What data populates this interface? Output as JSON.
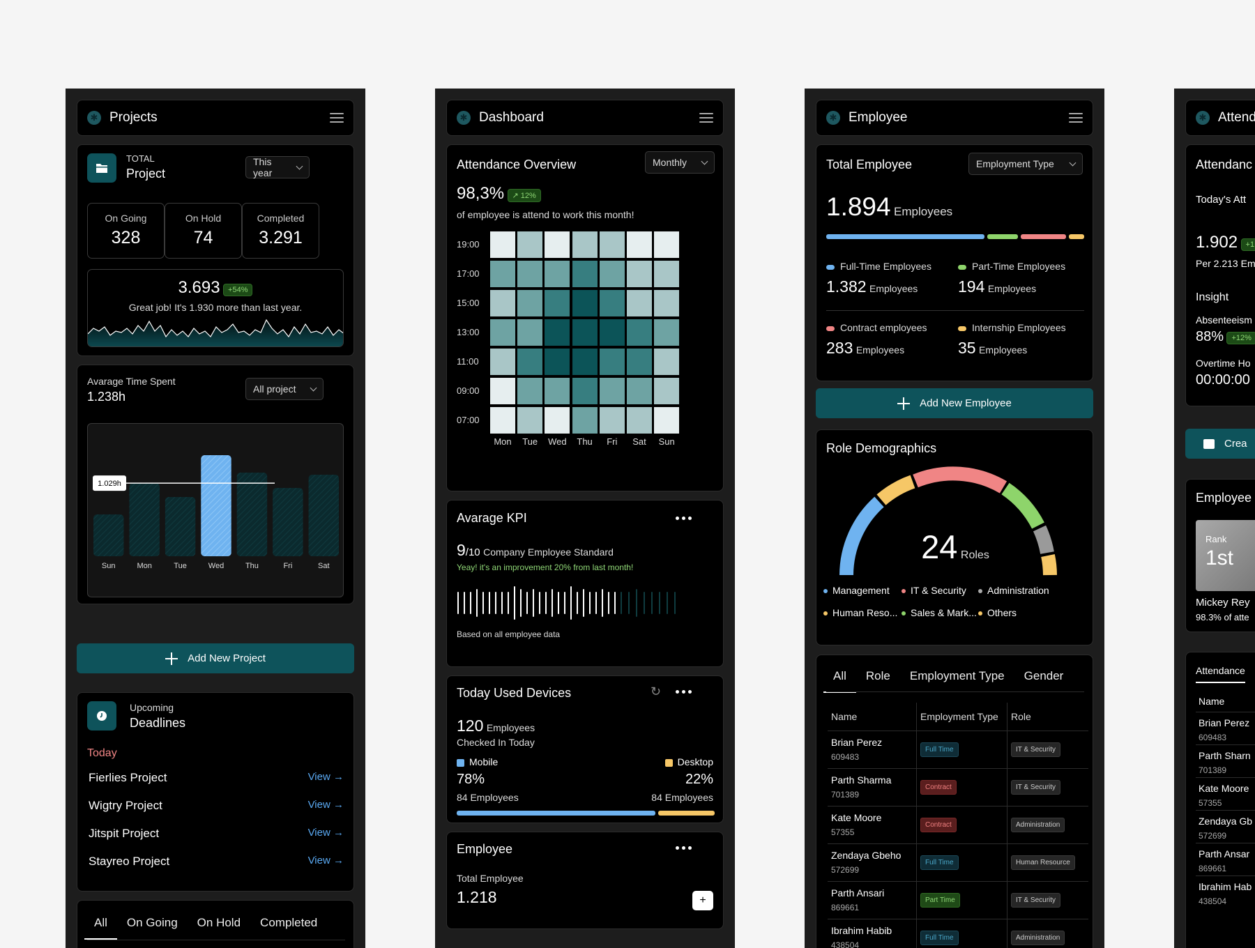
{
  "projects": {
    "title": "Projects",
    "total_label": "TOTAL",
    "total_title": "Project",
    "period": "This year",
    "stats": [
      {
        "label": "On Going",
        "value": "328"
      },
      {
        "label": "On Hold",
        "value": "74"
      },
      {
        "label": "Completed",
        "value": "3.291"
      }
    ],
    "total_value": "3.693",
    "total_badge": "+54%",
    "total_note": "Great job! It's 1.930 more than last year.",
    "avg_title": "Avarage Time Spent",
    "avg_value": "1.238h",
    "avg_filter": "All project",
    "chart_tooltip": "1.029h",
    "add_button": "Add New Project",
    "deadlines_label": "Upcoming",
    "deadlines_title": "Deadlines",
    "today_label": "Today",
    "deadlines": [
      {
        "name": "Fierlies Project",
        "action": "View"
      },
      {
        "name": "Wigtry Project",
        "action": "View"
      },
      {
        "name": "Jitspit Project",
        "action": "View"
      },
      {
        "name": "Stayreo Project",
        "action": "View"
      }
    ],
    "tabs": [
      "All",
      "On Going",
      "On Hold",
      "Completed"
    ]
  },
  "chart_data": {
    "type": "bar",
    "categories": [
      "Sun",
      "Mon",
      "Tue",
      "Wed",
      "Thu",
      "Fri",
      "Sat"
    ],
    "values": [
      0.6,
      1.05,
      0.85,
      1.45,
      1.2,
      0.98,
      1.17
    ],
    "highlight": "Wed",
    "reference_line": 1.029,
    "highlight_color": "#6fb3f0",
    "bar_color": "#0b2a2e"
  },
  "dashboard": {
    "title": "Dashboard",
    "att_title": "Attendance Overview",
    "att_filter": "Monthly",
    "att_value": "98,3%",
    "att_badge": "12%",
    "att_note": "of employee is attend to work this month!",
    "hours": [
      "19:00",
      "17:00",
      "15:00",
      "13:00",
      "11:00",
      "09:00",
      "07:00"
    ],
    "days": [
      "Mon",
      "Tue",
      "Wed",
      "Thu",
      "Fri",
      "Sat",
      "Sun"
    ],
    "heat": [
      [
        0,
        1,
        0,
        1,
        1,
        0,
        0
      ],
      [
        2,
        2,
        2,
        3,
        2,
        1,
        1
      ],
      [
        1,
        2,
        3,
        4,
        3,
        1,
        1
      ],
      [
        2,
        2,
        4,
        4,
        4,
        3,
        2
      ],
      [
        1,
        3,
        4,
        4,
        3,
        3,
        1
      ],
      [
        0,
        2,
        2,
        3,
        2,
        2,
        1
      ],
      [
        0,
        1,
        0,
        2,
        1,
        1,
        0
      ]
    ],
    "heat_colors": [
      "#e6eeef",
      "#a9c6c7",
      "#6ea3a3",
      "#377e80",
      "#0c5458"
    ],
    "kpi_title": "Avarage KPI",
    "kpi_value": "9",
    "kpi_denom": "/10",
    "kpi_label": "Company Employee Standard",
    "kpi_note": "Yeay! it's an improvement 20% from last month!",
    "kpi_footer": "Based on all employee data",
    "devices_title": "Today Used Devices",
    "devices_count": "120",
    "devices_count_label": "Employees",
    "devices_sub": "Checked In Today",
    "mobile_label": "Mobile",
    "mobile_pct": "78%",
    "mobile_emp": "84 Employees",
    "desktop_label": "Desktop",
    "desktop_pct": "22%",
    "desktop_emp": "84 Employees",
    "mobile_color": "#6fb3f0",
    "desktop_color": "#f6c767",
    "emp_title": "Employee",
    "emp_total_label": "Total Employee",
    "emp_total": "1.218",
    "emp_add": "+"
  },
  "employee": {
    "title": "Employee",
    "total_title": "Total Employee",
    "filter": "Employment Type",
    "total": "1.894",
    "total_unit": "Employees",
    "cats": [
      {
        "label": "Full-Time Employees",
        "value": "1.382",
        "unit": "Employees",
        "color": "#6fb3f0"
      },
      {
        "label": "Part-Time Employees",
        "value": "194",
        "unit": "Employees",
        "color": "#8ed46b"
      },
      {
        "label": "Contract employees",
        "value": "283",
        "unit": "Employees",
        "color": "#f08585"
      },
      {
        "label": "Internship Employees",
        "value": "35",
        "unit": "Employees",
        "color": "#f6c767"
      }
    ],
    "add_button": "Add New Employee",
    "role_title": "Role Demographics",
    "role_count": "24",
    "role_unit": "Roles",
    "role_legend": [
      {
        "label": "Management",
        "color": "#6fb3f0"
      },
      {
        "label": "IT & Security",
        "color": "#f08585"
      },
      {
        "label": "Administration",
        "color": "#aaaaaa"
      },
      {
        "label": "Human Reso...",
        "color": "#f6c767"
      },
      {
        "label": "Sales & Mark...",
        "color": "#8ed46b"
      },
      {
        "label": "Others",
        "color": "#f6c767"
      }
    ],
    "tabs": [
      "All",
      "Role",
      "Employment Type",
      "Gender"
    ],
    "cols": [
      "Name",
      "Employment Type",
      "Role"
    ],
    "rows": [
      {
        "name": "Brian Perez",
        "id": "609483",
        "type": "Full Time",
        "type_class": "p-full",
        "role": "IT & Security"
      },
      {
        "name": "Parth Sharma",
        "id": "701389",
        "type": "Contract",
        "type_class": "p-con",
        "role": "IT & Security"
      },
      {
        "name": "Kate Moore",
        "id": "57355",
        "type": "Contract",
        "type_class": "p-con",
        "role": "Administration"
      },
      {
        "name": "Zendaya Gbeho",
        "id": "572699",
        "type": "Full Time",
        "type_class": "p-full",
        "role": "Human Resource"
      },
      {
        "name": "Parth Ansari",
        "id": "869661",
        "type": "Part Time",
        "type_class": "p-part",
        "role": "IT & Security"
      },
      {
        "name": "Ibrahim Habib",
        "id": "438504",
        "type": "Full Time",
        "type_class": "p-full",
        "role": "Administration"
      }
    ]
  },
  "attendance": {
    "title": "Attenda",
    "card_title": "Attendanc",
    "today": "Today's Att",
    "value": "1.902",
    "badge": "+1",
    "per": "Per 2.213 Em",
    "insight": "Insight",
    "absent": "Absenteeism",
    "absent_val": "88%",
    "absent_badge": "+12%",
    "overtime": "Overtime Ho",
    "overtime_val": "00:00:00",
    "create": "Crea",
    "emp_title": "Employee",
    "rank_label": "Rank",
    "rank": "1st",
    "top_name": "Mickey Rey",
    "top_note": "98.3% of atte",
    "tab": "Attendance",
    "col": "Name",
    "rows": [
      {
        "name": "Brian Perez",
        "id": "609483"
      },
      {
        "name": "Parth Sharn",
        "id": "701389"
      },
      {
        "name": "Kate Moore",
        "id": "57355"
      },
      {
        "name": "Zendaya Gb",
        "id": "572699"
      },
      {
        "name": "Parth Ansar",
        "id": "869661"
      },
      {
        "name": "Ibrahim Hab",
        "id": "438504"
      }
    ]
  }
}
